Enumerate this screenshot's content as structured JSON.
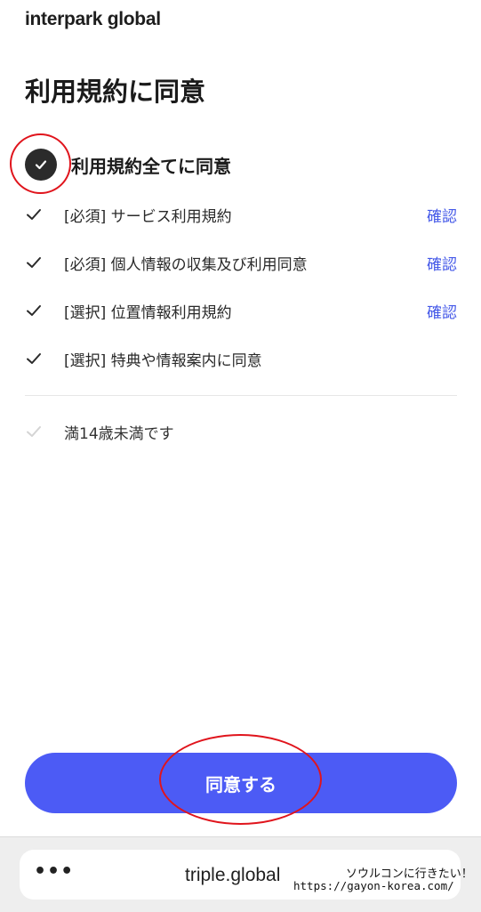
{
  "header": {
    "logo_text": "interpark global"
  },
  "page": {
    "title": "利用規約に同意"
  },
  "all_agree": {
    "label": "利用規約全てに同意",
    "checked": true
  },
  "terms": [
    {
      "label": "[必須] サービス利用規約",
      "link": "確認",
      "checked": true
    },
    {
      "label": "[必須] 個人情報の収集及び利用同意",
      "link": "確認",
      "checked": true
    },
    {
      "label": "[選択] 位置情報利用規約",
      "link": "確認",
      "checked": true
    },
    {
      "label": "[選択] 特典や情報案内に同意",
      "link": "",
      "checked": true
    }
  ],
  "age_check": {
    "label": "満14歳未満です",
    "checked": false
  },
  "actions": {
    "agree_button": "同意する"
  },
  "browser": {
    "menu_icon": "more-dots-icon",
    "menu_glyph": "•••",
    "url": "triple.global"
  },
  "watermark": {
    "title": "ソウルコンに行きたい！",
    "url": "https://gayon-korea.com/"
  },
  "colors": {
    "accent": "#4c5bf5",
    "link": "#4458e8",
    "annotation": "#e0141c"
  }
}
